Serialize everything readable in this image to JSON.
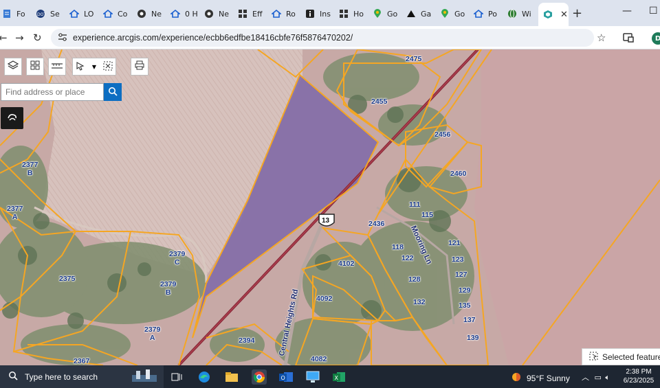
{
  "browser": {
    "tabs": [
      {
        "label": "Fo",
        "icon": "document-icon"
      },
      {
        "label": "Se",
        "icon": "dot-icon"
      },
      {
        "label": "LO",
        "icon": "zillow-icon"
      },
      {
        "label": "Co",
        "icon": "zillow-icon"
      },
      {
        "label": "Ne",
        "icon": "github-icon"
      },
      {
        "label": "0 H",
        "icon": "zillow-icon"
      },
      {
        "label": "Ne",
        "icon": "github-icon"
      },
      {
        "label": "Eff",
        "icon": "grid-icon"
      },
      {
        "label": "Ro",
        "icon": "zillow-icon"
      },
      {
        "label": "Ins",
        "icon": "info-icon"
      },
      {
        "label": "Ho",
        "icon": "grid-icon"
      },
      {
        "label": "Go",
        "icon": "maps-pin-icon"
      },
      {
        "label": "Ga",
        "icon": "triangle-icon"
      },
      {
        "label": "Go",
        "icon": "maps-pin-icon"
      },
      {
        "label": "Po",
        "icon": "zillow-icon"
      },
      {
        "label": "Wi",
        "icon": "globe-icon"
      }
    ],
    "active_tab_icon": "arcgis-icon",
    "url": "experience.arcgis.com/experience/ecbb6edfbe18416cbfe76f5876470202/",
    "profile_initial": "D"
  },
  "map_ui": {
    "search_placeholder": "Find address or place",
    "selected_features_label": "Selected feature",
    "toolbar": [
      "layers-icon",
      "basemap-gallery-icon",
      "measure-icon",
      "select-icon",
      "clear-selection-icon",
      "print-icon"
    ]
  },
  "parcels": [
    {
      "id": "2475",
      "name": "parcel-2475"
    },
    {
      "id": "2455",
      "name": "parcel-2455"
    },
    {
      "id": "2456",
      "name": "parcel-2456"
    },
    {
      "id": "2460",
      "name": "parcel-2460"
    },
    {
      "id": "2377\nB",
      "name": "parcel-2377-b"
    },
    {
      "id": "2377\nA",
      "name": "parcel-2377-a"
    },
    {
      "id": "2375",
      "name": "parcel-2375"
    },
    {
      "id": "2379\nC",
      "name": "parcel-2379-c"
    },
    {
      "id": "2379\nB",
      "name": "parcel-2379-b"
    },
    {
      "id": "2379\nA",
      "name": "parcel-2379-a"
    },
    {
      "id": "2367",
      "name": "parcel-2367"
    },
    {
      "id": "2394",
      "name": "parcel-2394"
    },
    {
      "id": "2436",
      "name": "parcel-2436"
    },
    {
      "id": "4102",
      "name": "parcel-4102"
    },
    {
      "id": "4092",
      "name": "parcel-4092"
    },
    {
      "id": "4082",
      "name": "parcel-4082"
    },
    {
      "id": "111",
      "name": "parcel-111"
    },
    {
      "id": "115",
      "name": "parcel-115"
    },
    {
      "id": "118",
      "name": "parcel-118"
    },
    {
      "id": "121",
      "name": "parcel-121"
    },
    {
      "id": "122",
      "name": "parcel-122"
    },
    {
      "id": "123",
      "name": "parcel-123"
    },
    {
      "id": "127",
      "name": "parcel-127"
    },
    {
      "id": "128",
      "name": "parcel-128"
    },
    {
      "id": "129",
      "name": "parcel-129"
    },
    {
      "id": "132",
      "name": "parcel-132"
    },
    {
      "id": "135",
      "name": "parcel-135"
    },
    {
      "id": "137",
      "name": "parcel-137"
    },
    {
      "id": "139",
      "name": "parcel-139"
    }
  ],
  "roads": {
    "central_heights": "Central Heights Rd",
    "mooring": "Mooring Ln",
    "route_shield": "13"
  },
  "taskbar": {
    "search_placeholder": "Type here to search",
    "weather": "95°F  Sunny",
    "time": "2:38 PM",
    "date": "6/23/2025"
  }
}
